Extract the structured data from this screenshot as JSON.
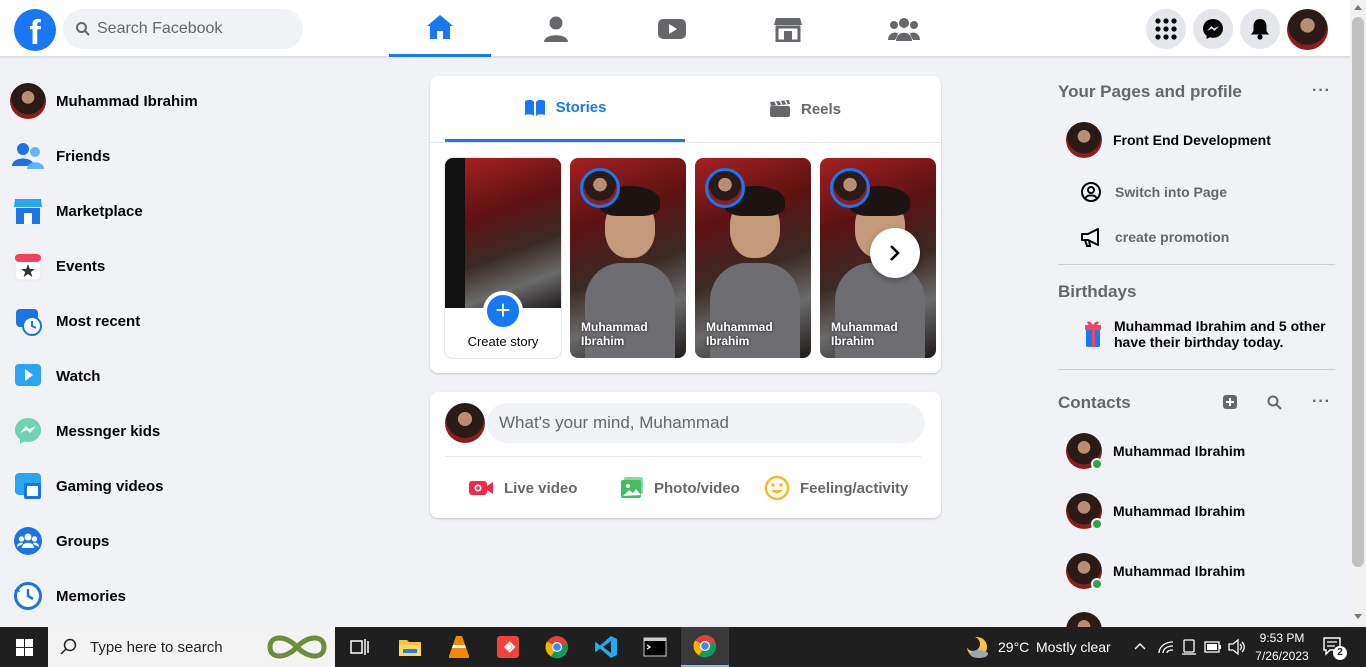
{
  "header": {
    "search_placeholder": "Search Facebook",
    "logo_letter": "f"
  },
  "profile": {
    "name": "Muhammad Ibrahim"
  },
  "sidebar": {
    "items": [
      {
        "label": "Friends",
        "icon": "friends-icon"
      },
      {
        "label": "Marketplace",
        "icon": "marketplace-icon"
      },
      {
        "label": "Events",
        "icon": "events-icon"
      },
      {
        "label": "Most recent",
        "icon": "most-recent-icon"
      },
      {
        "label": "Watch",
        "icon": "watch-icon"
      },
      {
        "label": "Messnger kids",
        "icon": "messenger-kids-icon"
      },
      {
        "label": "Gaming videos",
        "icon": "gaming-icon"
      },
      {
        "label": "Groups",
        "icon": "groups-icon"
      },
      {
        "label": "Memories",
        "icon": "memories-icon"
      }
    ]
  },
  "stories": {
    "tabs": [
      {
        "label": "Stories"
      },
      {
        "label": "Reels"
      }
    ],
    "create_label": "Create story",
    "plus": "+",
    "items": [
      {
        "name": "Muhammad Ibrahim"
      },
      {
        "name": "Muhammad Ibrahim"
      },
      {
        "name": "Muhammad Ibrahim"
      }
    ]
  },
  "composer": {
    "placeholder": "What's your mind, Muhammad",
    "actions": [
      {
        "label": "Live video",
        "color": "#f02849"
      },
      {
        "label": "Photo/video",
        "color": "#45bd62"
      },
      {
        "label": "Feeling/activity",
        "color": "#f7b928"
      }
    ]
  },
  "right": {
    "pages_heading": "Your Pages and profile",
    "page_name": "Front End Development",
    "switch_label": "Switch into Page",
    "promotion_label": "create promotion",
    "birthdays_heading": "Birthdays",
    "birthday_text_line1": "Muhammad Ibrahim and 5 other",
    "birthday_text_line2": "have their birthday today.",
    "contacts_heading": "Contacts",
    "more": "···",
    "contacts": [
      {
        "name": "Muhammad Ibrahim"
      },
      {
        "name": "Muhammad Ibrahim"
      },
      {
        "name": "Muhammad Ibrahim"
      }
    ]
  },
  "taskbar": {
    "search_placeholder": "Type here to search",
    "weather_temp": "29°C",
    "weather_text": "Mostly clear",
    "time": "9:53 PM",
    "date": "7/26/2023",
    "notification_count": "2"
  },
  "colors": {
    "accent": "#1877f2",
    "background": "#f0f2f5",
    "online": "#31a24c"
  }
}
